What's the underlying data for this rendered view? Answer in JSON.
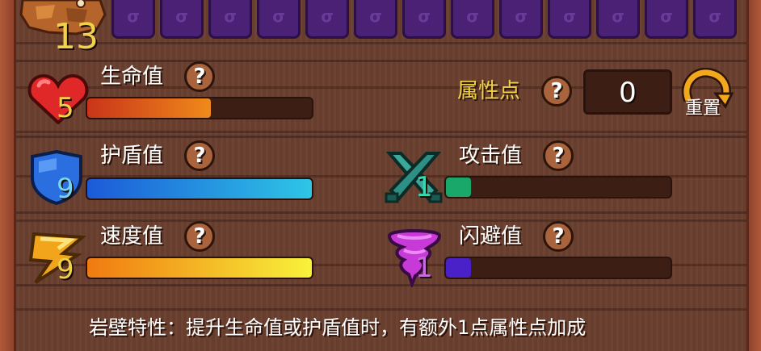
{
  "level": {
    "value": "13"
  },
  "slots": {
    "glyph": "σ"
  },
  "attribute_points": {
    "label": "属性点",
    "value": "0"
  },
  "reset": {
    "label": "重置"
  },
  "help_glyph": "?",
  "stats": {
    "health": {
      "label": "生命值",
      "value": "5",
      "fill_fraction": 0.55
    },
    "shield": {
      "label": "护盾值",
      "value": "9",
      "fill_fraction": 1.0
    },
    "speed": {
      "label": "速度值",
      "value": "9",
      "fill_fraction": 1.0
    },
    "attack": {
      "label": "攻击值",
      "value": "1",
      "fill_fraction": 0.11
    },
    "dodge": {
      "label": "闪避值",
      "value": "1",
      "fill_fraction": 0.11
    }
  },
  "footer": {
    "text": "岩壁特性：提升生命值或护盾值时，有额外1点属性点加成"
  },
  "colors": {
    "label_gold": "#f0d24a",
    "health_bar": [
      "#c9341a",
      "#f08a1a"
    ],
    "shield_bar": [
      "#1c5ad8",
      "#2ec6e6"
    ],
    "speed_bar": [
      "#f07a10",
      "#f8f23a"
    ],
    "attack_bar": "#1aa86a",
    "dodge_bar": "#4a20c8"
  }
}
